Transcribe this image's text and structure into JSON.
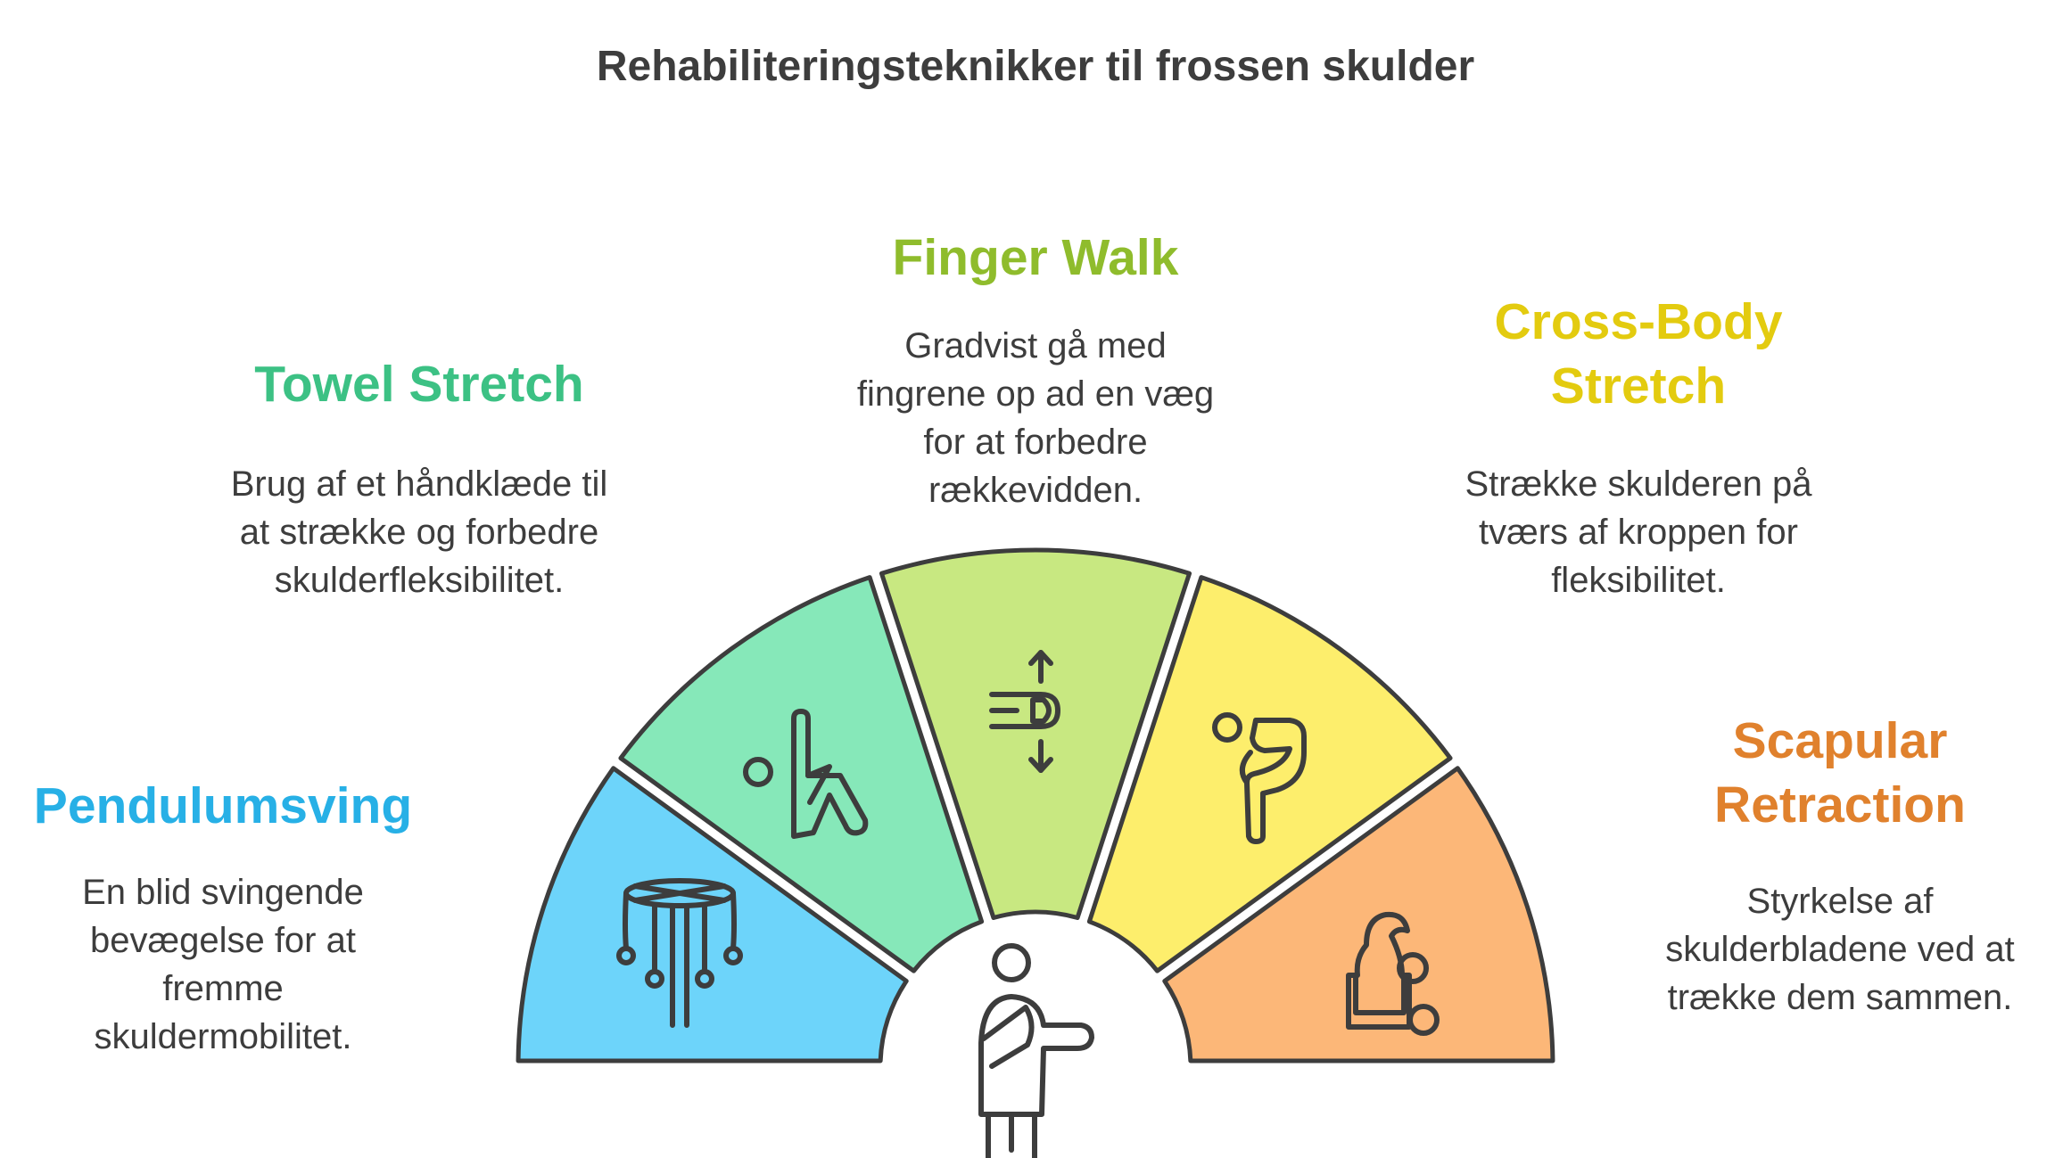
{
  "title": "Rehabiliteringsteknikker til frossen skulder",
  "colors": {
    "outline": "#3d3d3d",
    "text": "#3d3d3d"
  },
  "segments": [
    {
      "heading_lines": [
        "Pendulumsving"
      ],
      "description_lines": [
        "En blid svingende",
        "bevægelse for at",
        "fremme",
        "skuldermobilitet."
      ],
      "fill": "#6dd4fa",
      "heading_color": "#27b0e6",
      "icon": "dreamcatcher-icon"
    },
    {
      "heading_lines": [
        "Towel Stretch"
      ],
      "description_lines": [
        "Brug af et håndklæde til",
        "at strække og forbedre",
        "skulderfleksibilitet."
      ],
      "fill": "#86e8b9",
      "heading_color": "#3cc184",
      "icon": "yoga-stretch-icon"
    },
    {
      "heading_lines": [
        "Finger Walk"
      ],
      "description_lines": [
        "Gradvist gå med",
        "fingrene op ad en væg",
        "for at forbedre",
        "rækkevidden."
      ],
      "fill": "#c8e881",
      "heading_color": "#8fbc2c",
      "icon": "finger-up-down-icon"
    },
    {
      "heading_lines": [
        "Cross-Body",
        "Stretch"
      ],
      "description_lines": [
        "Strække skulderen på",
        "tværs af kroppen for",
        "fleksibilitet."
      ],
      "fill": "#fdee6c",
      "heading_color": "#e3cb0f",
      "icon": "cross-body-stretch-icon"
    },
    {
      "heading_lines": [
        "Scapular",
        "Retraction"
      ],
      "description_lines": [
        "Styrkelse af",
        "skulderbladene ved at",
        "trække dem sammen."
      ],
      "fill": "#fcb778",
      "heading_color": "#e0812d",
      "icon": "scapular-exercise-icon"
    }
  ],
  "center_icon": "injured-arm-person-icon"
}
